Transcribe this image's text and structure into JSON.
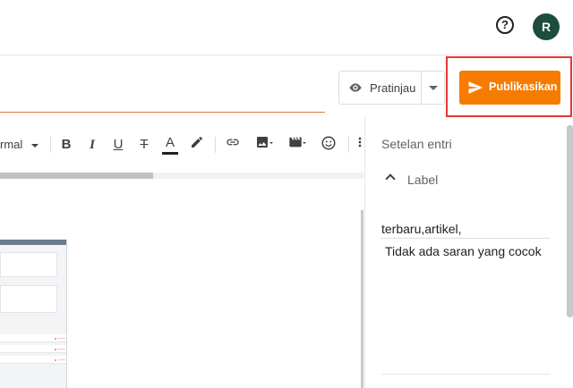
{
  "header": {
    "help_icon": "help-circle-icon",
    "help_glyph": "?",
    "avatar_letter": "R"
  },
  "actions": {
    "preview_label": "Pratinjau",
    "publish_label": "Publikasikan",
    "accent_color": "#f57c00"
  },
  "toolbar": {
    "format_label": "rmal",
    "bold": "B",
    "italic": "I",
    "underline": "U",
    "strike": "T",
    "text_color": "A"
  },
  "side_panel": {
    "title": "Setelan entri",
    "label_heading": "Label",
    "label_value": "terbaru,artikel,",
    "suggestion_text": "Tidak ada saran yang cocok"
  }
}
